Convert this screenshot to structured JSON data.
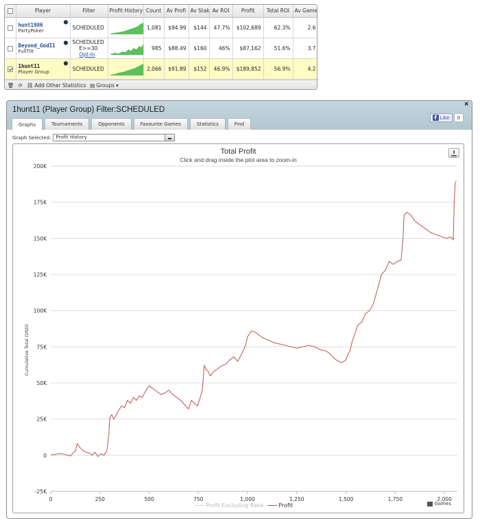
{
  "player_table": {
    "headers": [
      "Player",
      "Filter",
      "Profit History",
      "Count",
      "Av Profi",
      "Av Stak",
      "Av ROI",
      "Profit",
      "Total ROI",
      "Av Games"
    ],
    "rows": [
      {
        "name": "hunt1986",
        "site": "PartyPoker",
        "filter": "SCHEDULED",
        "filter2": "",
        "filter_link": "",
        "count": "1,081",
        "av_profit": "$94.99",
        "av_stake": "$144",
        "av_roi": "47.7%",
        "profit": "$102,689",
        "total_roi": "62.3%",
        "av_games": "2.6",
        "checked": false
      },
      {
        "name": "Beyond_GodI1",
        "site": "FullTilt",
        "filter": "SCHEDULED",
        "filter2": "E>=30",
        "filter_link": "Opt-In",
        "count": "985",
        "av_profit": "$88.49",
        "av_stake": "$160",
        "av_roi": "46%",
        "profit": "$87,162",
        "total_roi": "51.6%",
        "av_games": "3.7",
        "checked": false
      },
      {
        "name": "1hunt11",
        "site": "Player Group",
        "filter": "SCHEDULED",
        "filter2": "",
        "filter_link": "",
        "count": "2,066",
        "av_profit": "$91.89",
        "av_stake": "$152",
        "av_roi": "46.9%",
        "profit": "$189,852",
        "total_roi": "56.9%",
        "av_games": "4.2",
        "checked": true
      }
    ],
    "toolbar": {
      "add_label": "Add Other Statistics",
      "groups_label": "Groups"
    }
  },
  "graph_panel": {
    "title": "1hunt11 (Player Group) Filter:SCHEDULED",
    "close": "×",
    "like_label": "Like",
    "like_count": "0",
    "tabs": [
      "Graphs",
      "Tournaments",
      "Opponents",
      "Favourite Games",
      "Statistics",
      "Find"
    ],
    "active_tab": 0,
    "graph_selected_label": "Graph Selected:",
    "graph_selected_value": "Profit History"
  },
  "chart_data": {
    "type": "line",
    "title": "Total Profit",
    "subtitle": "Click and drag inside the plot area to zoom-in",
    "ylabel": "Cumulative Total (USD)",
    "xlim": [
      0,
      2066
    ],
    "ylim": [
      -25000,
      200000
    ],
    "xticks": [
      0,
      250,
      500,
      750,
      1000,
      1250,
      1500,
      1750,
      2000
    ],
    "xtick_labels": [
      "0",
      "250",
      "500",
      "750",
      "1,000",
      "1,250",
      "1,500",
      "1,750",
      "2,000"
    ],
    "yticks": [
      -25000,
      0,
      25000,
      50000,
      75000,
      100000,
      125000,
      150000,
      175000,
      200000
    ],
    "ytick_labels": [
      "-25K",
      "0",
      "25K",
      "50K",
      "75K",
      "100K",
      "125K",
      "150K",
      "175K",
      "200K"
    ],
    "grid": true,
    "legend": [
      "Profit Excluding Rake",
      "Profit"
    ],
    "legend_games": "Games",
    "colors": {
      "profit": "#c0504d",
      "excluding": "#d6d6d6",
      "grid": "#dddddd"
    },
    "series": [
      {
        "name": "Profit",
        "x": [
          0,
          20,
          40,
          60,
          80,
          100,
          110,
          125,
          135,
          150,
          165,
          180,
          195,
          210,
          225,
          240,
          255,
          270,
          285,
          295,
          300,
          310,
          320,
          330,
          345,
          360,
          375,
          390,
          405,
          420,
          435,
          450,
          465,
          480,
          500,
          520,
          540,
          560,
          580,
          600,
          620,
          640,
          660,
          680,
          700,
          715,
          730,
          745,
          760,
          770,
          780,
          790,
          800,
          810,
          830,
          850,
          870,
          890,
          910,
          930,
          950,
          970,
          990,
          1000,
          1020,
          1040,
          1060,
          1080,
          1100,
          1130,
          1160,
          1190,
          1220,
          1250,
          1280,
          1310,
          1340,
          1370,
          1400,
          1420,
          1440,
          1460,
          1480,
          1500,
          1510,
          1520,
          1530,
          1545,
          1560,
          1580,
          1600,
          1620,
          1640,
          1660,
          1680,
          1700,
          1720,
          1740,
          1760,
          1780,
          1790,
          1795,
          1810,
          1830,
          1850,
          1870,
          1890,
          1910,
          1930,
          1950,
          1970,
          1990,
          2010,
          2030,
          2040,
          2045,
          2050,
          2055,
          2060
        ],
        "y": [
          0,
          500,
          1000,
          1000,
          200,
          -500,
          1000,
          3000,
          8000,
          5000,
          3000,
          2000,
          1500,
          0,
          2000,
          -1000,
          1000,
          0,
          3000,
          14000,
          26000,
          28000,
          25000,
          27000,
          31000,
          34000,
          33000,
          38000,
          36000,
          40000,
          38000,
          41000,
          40000,
          44000,
          48000,
          46000,
          44000,
          42000,
          43000,
          45000,
          42000,
          40000,
          38000,
          35000,
          32000,
          38000,
          36000,
          34000,
          40000,
          45000,
          62000,
          59000,
          58000,
          55000,
          58000,
          60000,
          62000,
          63000,
          66000,
          68000,
          65000,
          70000,
          76000,
          82000,
          86000,
          85000,
          83000,
          81000,
          80000,
          78000,
          77000,
          76000,
          75000,
          74000,
          75000,
          76000,
          75000,
          73000,
          72000,
          70000,
          67000,
          65000,
          64000,
          66000,
          70000,
          72000,
          78000,
          84000,
          90000,
          92000,
          98000,
          100000,
          105000,
          115000,
          125000,
          128000,
          134000,
          132000,
          134000,
          135000,
          150000,
          166000,
          168000,
          166000,
          162000,
          160000,
          158000,
          156000,
          154000,
          153000,
          152000,
          151000,
          150000,
          151000,
          150000,
          149000,
          175000,
          188000,
          189852
        ]
      }
    ]
  }
}
